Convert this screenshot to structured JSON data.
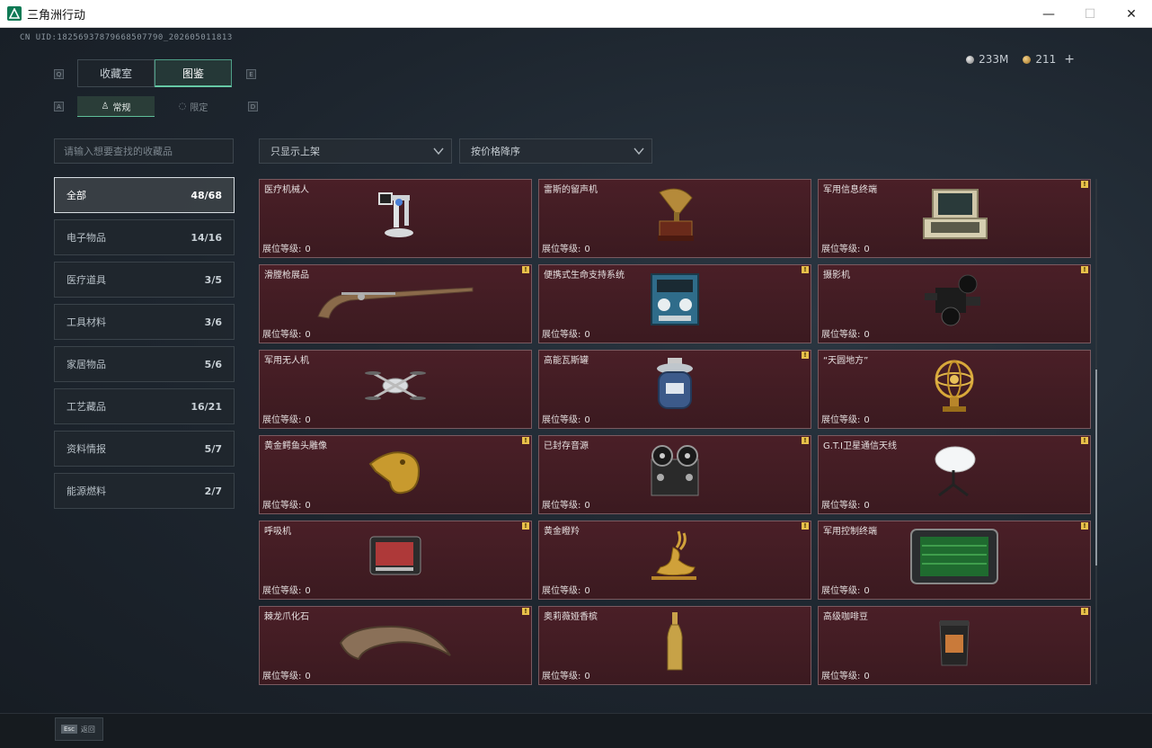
{
  "window": {
    "title": "三角洲行动",
    "minimize": "—",
    "maximize": "☐",
    "close": "✕"
  },
  "uid": "CN UID:18256937879668507790_202605011813",
  "currency": {
    "silver": "233M",
    "gold": "211",
    "plus": "+"
  },
  "hints": {
    "q": "Q",
    "e": "E",
    "a": "A",
    "d": "D"
  },
  "tabs": [
    {
      "label": "收藏室"
    },
    {
      "label": "图鉴"
    }
  ],
  "subtabs": [
    {
      "label": "常规"
    },
    {
      "label": "限定"
    }
  ],
  "search": {
    "placeholder": "请输入想要查找的收藏品"
  },
  "filters": {
    "display": "只显示上架",
    "sort": "按价格降序"
  },
  "categories": [
    {
      "label": "全部",
      "count": "48/68"
    },
    {
      "label": "电子物品",
      "count": "14/16"
    },
    {
      "label": "医疗道具",
      "count": "3/5"
    },
    {
      "label": "工具材料",
      "count": "3/6"
    },
    {
      "label": "家居物品",
      "count": "5/6"
    },
    {
      "label": "工艺藏品",
      "count": "16/21"
    },
    {
      "label": "资料情报",
      "count": "5/7"
    },
    {
      "label": "能源燃料",
      "count": "2/7"
    }
  ],
  "level_label": "展位等级:",
  "items": [
    {
      "name": "医疗机械人",
      "level": "0",
      "icon": "medical-robot-icon",
      "badge": ""
    },
    {
      "name": "雷斯的留声机",
      "level": "0",
      "icon": "gramophone-icon",
      "badge": ""
    },
    {
      "name": "军用信息终端",
      "level": "0",
      "icon": "military-terminal-icon",
      "badge": "!"
    },
    {
      "name": "滑膛枪展品",
      "level": "0",
      "icon": "musket-icon",
      "badge": "!"
    },
    {
      "name": "便携式生命支持系统",
      "level": "0",
      "icon": "life-support-icon",
      "badge": "!"
    },
    {
      "name": "摄影机",
      "level": "0",
      "icon": "camera-icon",
      "badge": "!"
    },
    {
      "name": "军用无人机",
      "level": "0",
      "icon": "drone-icon",
      "badge": ""
    },
    {
      "name": "高能瓦斯罐",
      "level": "0",
      "icon": "gas-canister-icon",
      "badge": "!"
    },
    {
      "name": "“天圆地方”",
      "level": "0",
      "icon": "armillary-sphere-icon",
      "badge": ""
    },
    {
      "name": "黄金鳄鱼头雕像",
      "level": "0",
      "icon": "gold-crocodile-icon",
      "badge": "!"
    },
    {
      "name": "已封存音源",
      "level": "0",
      "icon": "reel-recorder-icon",
      "badge": "!"
    },
    {
      "name": "G.T.I卫星通信天线",
      "level": "0",
      "icon": "satellite-dish-icon",
      "badge": "!"
    },
    {
      "name": "呼吸机",
      "level": "0",
      "icon": "ventilator-icon",
      "badge": "!"
    },
    {
      "name": "黄金瞪羚",
      "level": "0",
      "icon": "gold-gazelle-icon",
      "badge": "!"
    },
    {
      "name": "军用控制终端",
      "level": "0",
      "icon": "control-terminal-icon",
      "badge": "!"
    },
    {
      "name": "棘龙爪化石",
      "level": "0",
      "icon": "claw-fossil-icon",
      "badge": "!"
    },
    {
      "name": "奥莉薇娅香槟",
      "level": "0",
      "icon": "champagne-icon",
      "badge": ""
    },
    {
      "name": "高级咖啡豆",
      "level": "0",
      "icon": "coffee-bag-icon",
      "badge": "!"
    }
  ],
  "footer": {
    "esc_key": "Esc",
    "esc_label": "返回"
  }
}
